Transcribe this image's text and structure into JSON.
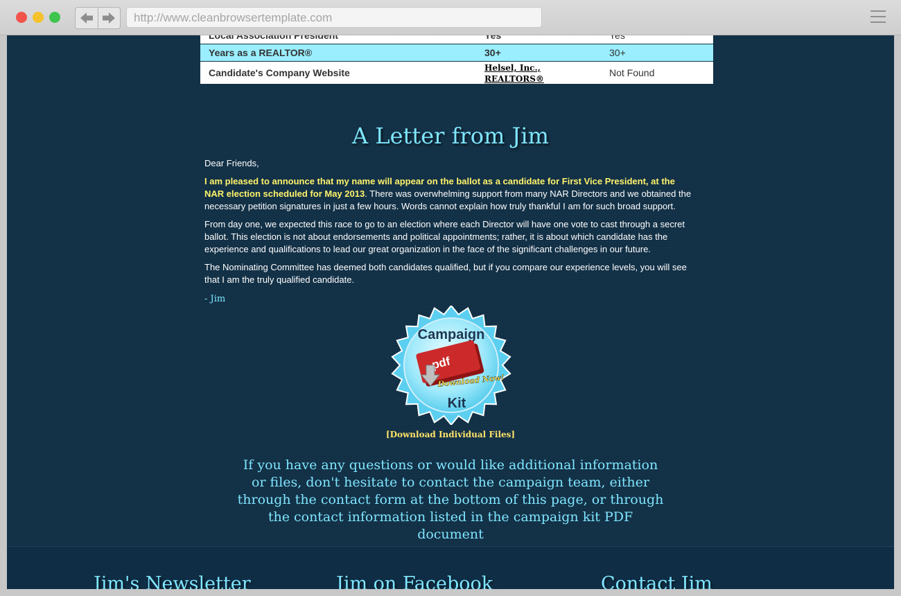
{
  "browser": {
    "url": "http://www.cleanbrowsertemplate.com"
  },
  "table": {
    "rows": [
      {
        "label": "Local Association President",
        "jim": "Yes",
        "opponent": "Yes"
      },
      {
        "label": "Years as a REALTOR®",
        "jim": "30+",
        "opponent": "30+"
      },
      {
        "label": "Candidate's Company Website",
        "jim": "Helsel, Inc., REALTORS®",
        "opponent": "Not Found"
      }
    ]
  },
  "letter": {
    "title": "A Letter from Jim",
    "greeting": "Dear Friends,",
    "p1_highlight": "I am pleased to announce that my name will appear on the ballot as a candidate for First Vice President, at the NAR election scheduled for May 2013",
    "p1_rest": ". There was overwhelming support from many NAR Directors and we obtained the necessary petition signatures in just a few hours. Words cannot explain how truly thankful I am for such broad support.",
    "p2": "From day one, we expected this race to go to an election where each Director will have one vote to cast through a secret ballot. This election is not about endorsements and political appointments; rather, it is about which candidate has the experience and qualifications to lead our great organization in the face of the significant challenges in our future.",
    "p3": "The Nominating Committee has deemed both candidates qualified, but if you compare our experience levels, you will see that I am the truly qualified candidate.",
    "signature": "- Jim"
  },
  "campaign_kit": {
    "top": "Campaign",
    "pdf": ".pdf",
    "download": "Download Now!",
    "bottom": "Kit",
    "link": "[Download Individual Files]"
  },
  "contact_text": "If you have any questions or would like additional information or files, don't hesitate to contact the campaign team, either through the contact form at the bottom of this page, or through the contact information listed in the campaign kit PDF document",
  "footer": {
    "newsletter": "Jim's Newsletter",
    "facebook": "Jim on Facebook",
    "contact": "Contact Jim"
  },
  "colors": {
    "page_bg": "#123046",
    "accent_cyan": "#7fe6ff",
    "highlight_yellow": "#fff36a",
    "table_highlight_row": "#9aeefe"
  }
}
